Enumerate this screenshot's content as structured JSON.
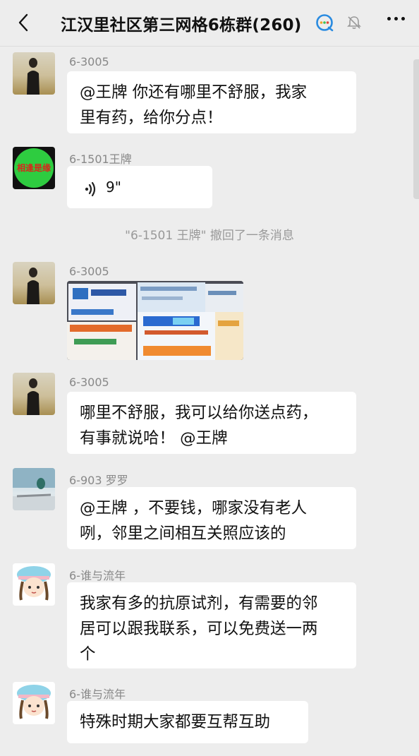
{
  "header": {
    "title": "江汉里社区第三网格6栋群(260)",
    "back_icon": "back-arrow-icon",
    "group_icon": "group-chat-icon",
    "mute_icon": "bell-muted-icon",
    "more_icon": "more-dots-icon"
  },
  "messages": [
    {
      "sender": "6-3005",
      "avatar": "avatar-man-in-field",
      "text_lines": [
        "@王牌  你还有哪里不舒服，我家",
        "里有药，给你分点！"
      ]
    },
    {
      "sender": "6-1501王牌",
      "avatar": "avatar-green-circle",
      "avatar_text": "相逢是缘",
      "voice_duration": "9\"",
      "voice_icon": "voice-wave-icon"
    },
    {
      "sender": "6-3005",
      "avatar": "avatar-man-in-field",
      "image": "medicine-boxes-photo"
    },
    {
      "sender": "6-3005",
      "avatar": "avatar-man-in-field",
      "text_lines": [
        "哪里不舒服，我可以给你送点药，",
        "有事就说哈！ @王牌"
      ]
    },
    {
      "sender": "6-903 罗罗",
      "avatar": "avatar-sports-scene",
      "text_lines": [
        "@王牌 ，不要钱，哪家没有老人",
        "咧，邻里之间相互关照应该的"
      ]
    },
    {
      "sender": "6-谁与流年",
      "avatar": "avatar-cartoon-girl",
      "text_lines": [
        "我家有多的抗原试剂，有需要的邻",
        "居可以跟我联系，可以免费送一两",
        "个"
      ]
    },
    {
      "sender": "6-谁与流年",
      "avatar": "avatar-cartoon-girl",
      "text_lines": [
        "特殊时期大家都要互帮互助"
      ]
    }
  ],
  "system_notice": "\"6-1501 王牌\" 撤回了一条消息",
  "colors": {
    "background": "#ededed",
    "bubble": "#ffffff",
    "nickname": "#888888",
    "system": "#999999"
  }
}
